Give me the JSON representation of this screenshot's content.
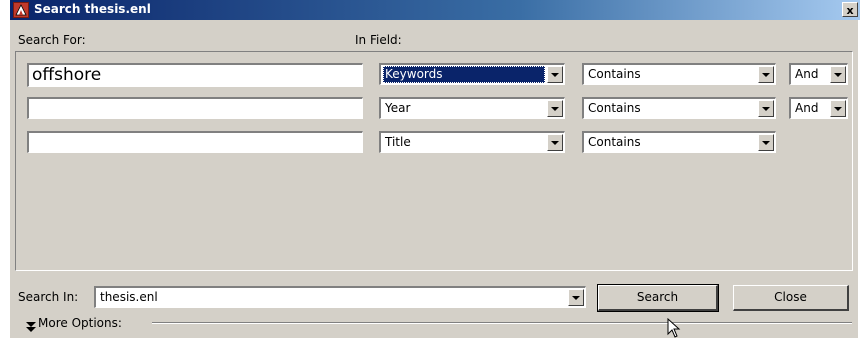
{
  "window": {
    "title": "Search thesis.enl",
    "close_label": "x"
  },
  "labels": {
    "search_for": "Search For:",
    "in_field": "In Field:",
    "search_in": "Search In:",
    "more_options": "More Options:"
  },
  "rows": [
    {
      "term": "offshore",
      "field": "Keywords",
      "operator": "Contains",
      "connector": "And"
    },
    {
      "term": "",
      "field": "Year",
      "operator": "Contains",
      "connector": "And"
    },
    {
      "term": "",
      "field": "Title",
      "operator": "Contains"
    }
  ],
  "search_in": {
    "value": "thesis.enl"
  },
  "buttons": {
    "search": "Search",
    "close": "Close"
  },
  "icons": {
    "dropdown": "chevron-down-icon",
    "more_options": "double-chevron-down-icon",
    "cursor": "mouse-pointer-icon"
  }
}
